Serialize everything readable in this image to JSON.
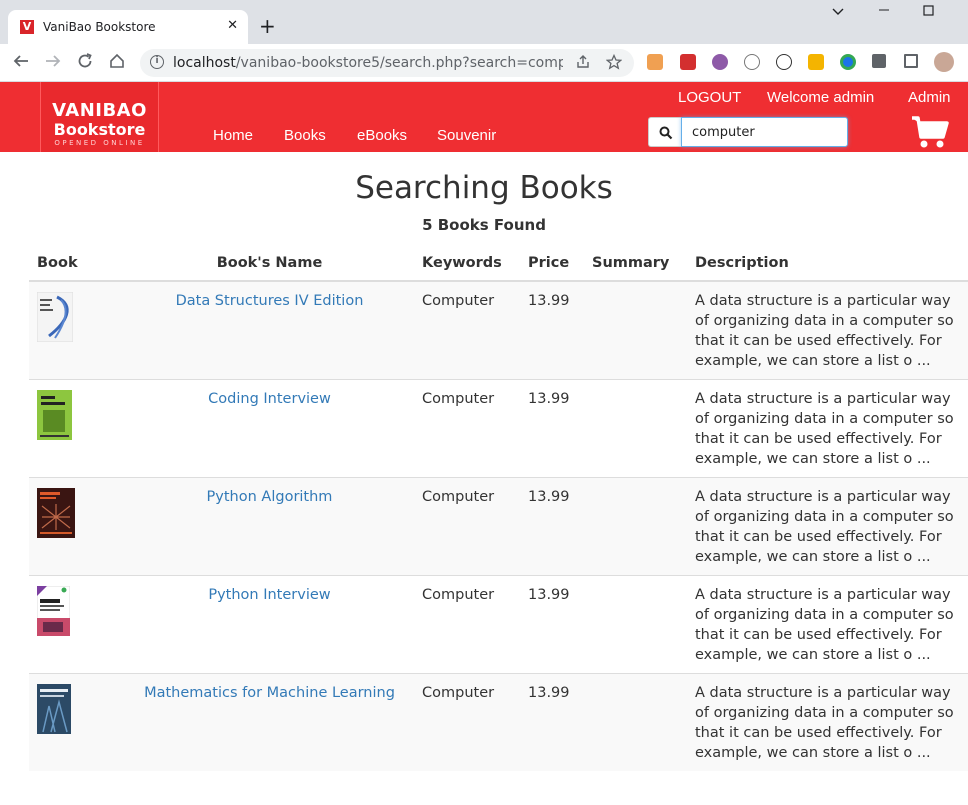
{
  "browser": {
    "tab_title": "VaniBao Bookstore",
    "tab_favicon_letter": "V",
    "url_host": "localhost",
    "url_rest": "/vanibao-bookstore5/search.php?search=comp..."
  },
  "header": {
    "logo_line1": "VANIBAO",
    "logo_line2": "Bookstore",
    "logo_line3": "OPENED ONLINE",
    "nav": [
      "Home",
      "Books",
      "eBooks",
      "Souvenir"
    ],
    "logout": "LOGOUT",
    "welcome": "Welcome admin",
    "admin": "Admin",
    "search_value": "computer"
  },
  "content": {
    "title": "Searching Books",
    "found": "5 Books Found",
    "columns": [
      "Book",
      "Book's Name",
      "Keywords",
      "Price",
      "Summary",
      "Description"
    ],
    "rows": [
      {
        "name": "Data Structures IV Edition",
        "keywords": "Computer",
        "price": "13.99",
        "summary": "",
        "description": "A data structure is a particular way of organizing data in a computer so that it can be used effectively. For example, we can store a list o ..."
      },
      {
        "name": "Coding Interview",
        "keywords": "Computer",
        "price": "13.99",
        "summary": "",
        "description": "A data structure is a particular way of organizing data in a computer so that it can be used effectively. For example, we can store a list o ..."
      },
      {
        "name": "Python Algorithm",
        "keywords": "Computer",
        "price": "13.99",
        "summary": "",
        "description": "A data structure is a particular way of organizing data in a computer so that it can be used effectively. For example, we can store a list o ..."
      },
      {
        "name": "Python Interview",
        "keywords": "Computer",
        "price": "13.99",
        "summary": "",
        "description": "A data structure is a particular way of organizing data in a computer so that it can be used effectively. For example, we can store a list o ..."
      },
      {
        "name": "Mathematics for Machine Learning",
        "keywords": "Computer",
        "price": "13.99",
        "summary": "",
        "description": "A data structure is a particular way of organizing data in a computer so that it can be used effectively. For example, we can store a list o ..."
      }
    ]
  },
  "colors": {
    "header_red": "#ef2e32",
    "link_blue": "#337ab7",
    "row_alt": "#f9f9f9"
  }
}
